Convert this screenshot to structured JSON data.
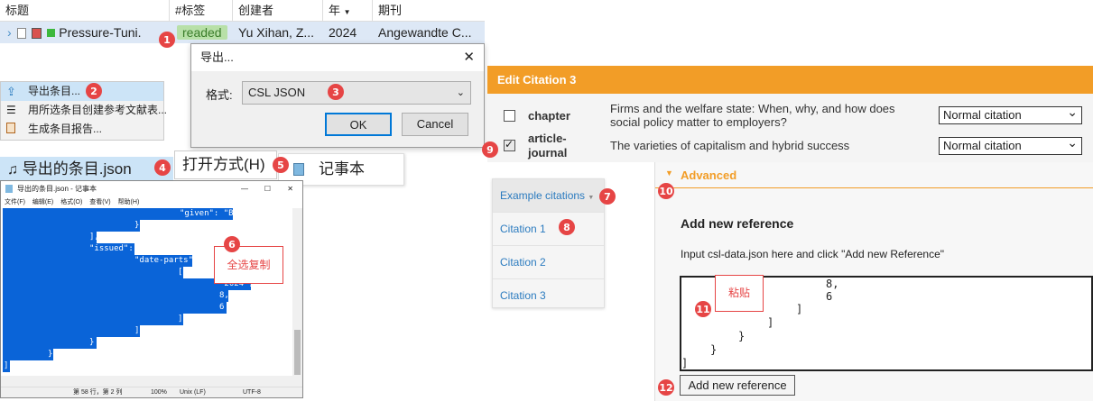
{
  "zotero": {
    "columns": [
      "标题",
      "#标签",
      "创建者",
      "年",
      "期刊"
    ],
    "row": {
      "title": "Pressure-Tuni.",
      "tag": "readed",
      "creator": "Yu Xihan, Z...",
      "year": "2024",
      "journal": "Angewandte C..."
    }
  },
  "export_dialog": {
    "title": "导出...",
    "format_label": "格式:",
    "format_value": "CSL JSON",
    "ok": "OK",
    "cancel": "Cancel"
  },
  "context_menu": {
    "items": [
      "导出条目...",
      "用所选条目创建参考文献表...",
      "生成条目报告..."
    ]
  },
  "file": {
    "name": "导出的条目.json",
    "open_with": "打开方式(H)",
    "notepad": "记事本"
  },
  "notepad": {
    "title": "导出的条目.json - 记事本",
    "menu": [
      "文件(F)",
      "编辑(E)",
      "格式(O)",
      "查看(V)",
      "帮助(H)"
    ],
    "lines": {
      "given": "\"given\": \"Bo\"",
      "brace1": "}",
      "bracket1": "],",
      "issued": "\"issued\": {",
      "date_parts": "\"date-parts\": [",
      "open_bracket": "[",
      "year": "\"2024\",",
      "eight": "8,",
      "six": "6",
      "close_b1": "]",
      "close_b2": "]",
      "close_c1": "}",
      "close_c2": "}",
      "close_last": "]"
    },
    "status": {
      "pos": "第 58 行，第 2 列",
      "zoom": "100%",
      "eol": "Unix (LF)",
      "enc": "UTF-8"
    },
    "callout": "全选复制"
  },
  "citation_editor": {
    "header": "Edit Citation 3",
    "rows": [
      {
        "type": "chapter",
        "title": "Firms and the welfare state: When, why, and how does social policy matter to employers?",
        "mode": "Normal citation",
        "checked": false
      },
      {
        "type": "article-journal",
        "title": "The varieties of capitalism and hybrid success",
        "mode": "Normal citation",
        "checked": true
      }
    ],
    "sidebar": [
      "Example citations",
      "Citation 1",
      "Citation 2",
      "Citation 3"
    ],
    "advanced": "Advanced",
    "add_title": "Add new reference",
    "add_desc": "Input csl-data.json here and click \"Add new Reference\"",
    "textarea_lines": [
      "8,",
      "6",
      "]",
      "]",
      "}",
      "}",
      "]"
    ],
    "paste_callout": "粘贴",
    "add_button": "Add new reference"
  },
  "steps": [
    "1",
    "2",
    "3",
    "4",
    "5",
    "6",
    "7",
    "8",
    "9",
    "10",
    "11",
    "12"
  ],
  "colors": {
    "accent": "#f29d27",
    "step": "#e64545",
    "selection": "#0a64d8",
    "link": "#2b7bbf"
  }
}
